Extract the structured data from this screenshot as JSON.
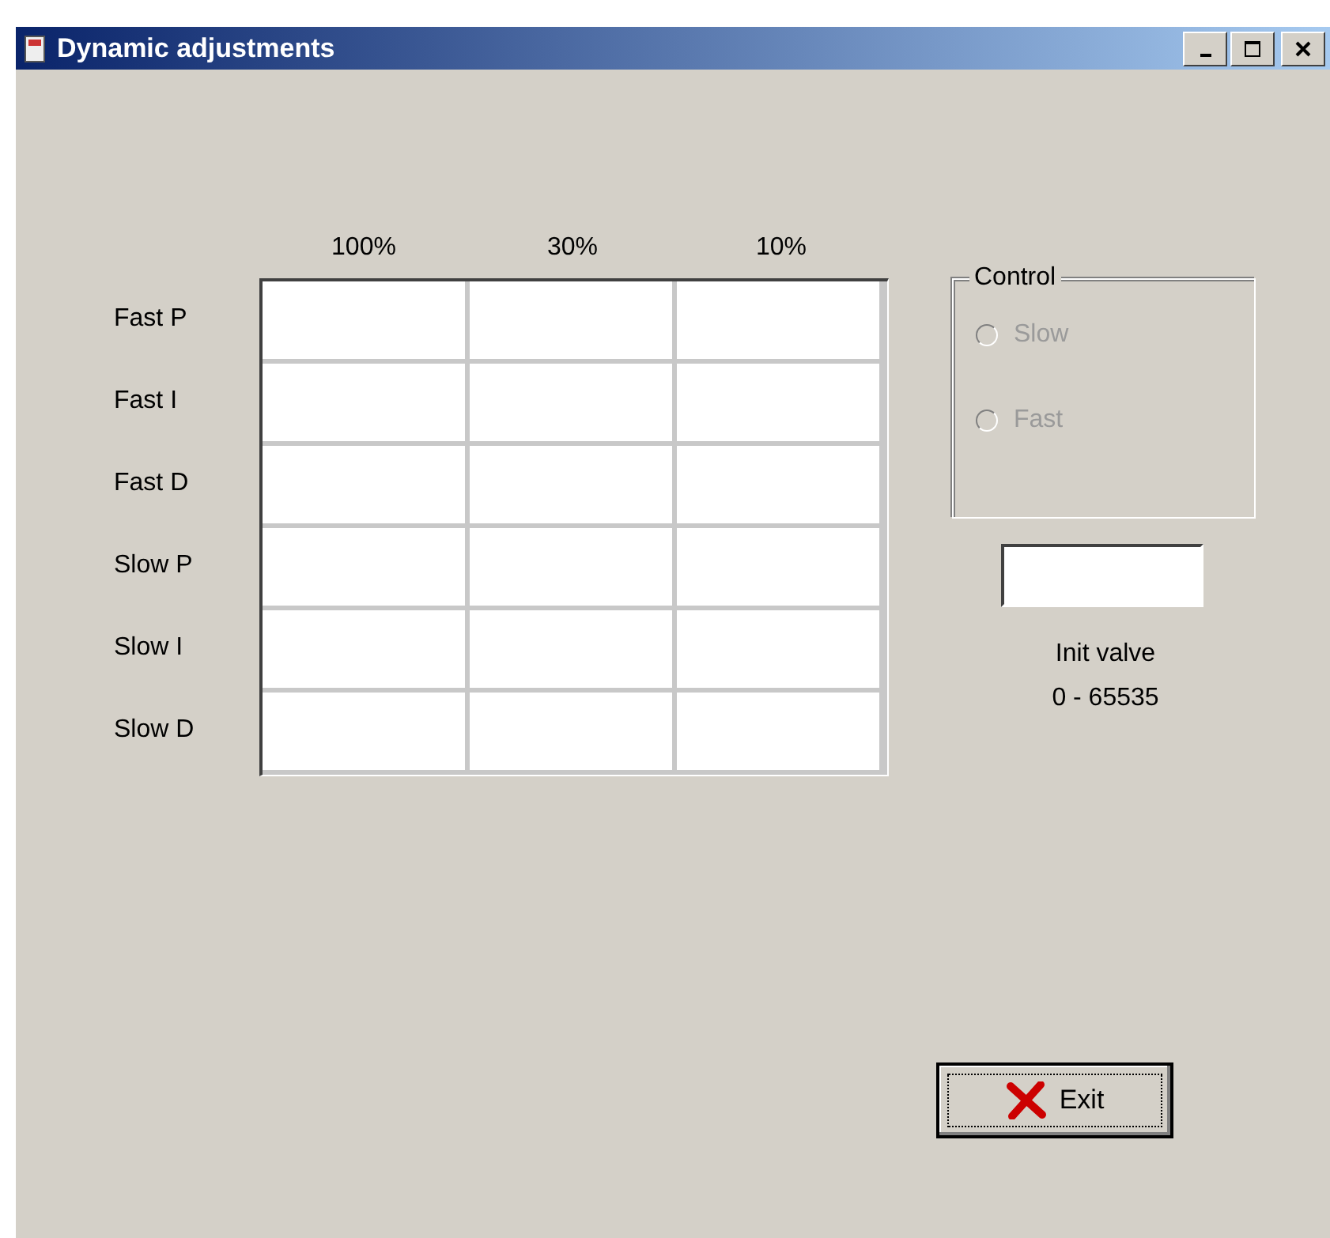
{
  "window": {
    "title": "Dynamic adjustments"
  },
  "grid": {
    "columns": [
      "100%",
      "30%",
      "10%"
    ],
    "rows": [
      "Fast P",
      "Fast I",
      "Fast D",
      "Slow P",
      "Slow I",
      "Slow D"
    ]
  },
  "control": {
    "title": "Control",
    "options": [
      {
        "label": "Slow",
        "selected": false,
        "disabled": true
      },
      {
        "label": "Fast",
        "selected": false,
        "disabled": true
      }
    ]
  },
  "init_caption": [
    "Init valve",
    "0 - 65535"
  ],
  "exit_button": {
    "label": "Exit"
  }
}
